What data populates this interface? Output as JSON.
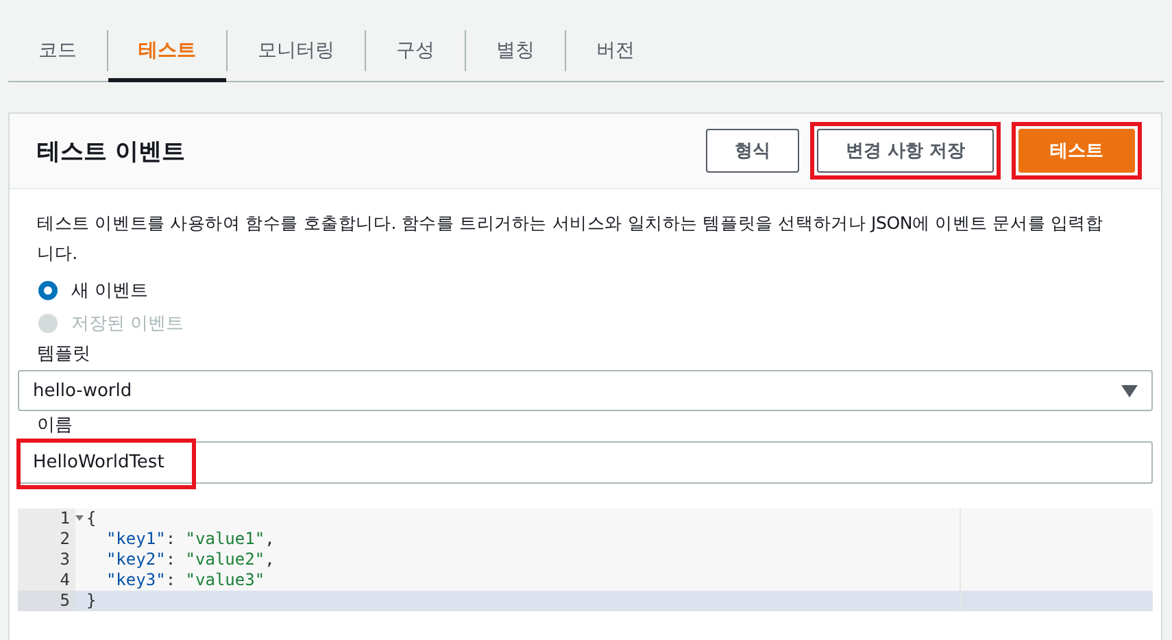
{
  "tabs": [
    {
      "label": "코드",
      "selected": false
    },
    {
      "label": "테스트",
      "selected": true
    },
    {
      "label": "모니터링",
      "selected": false
    },
    {
      "label": "구성",
      "selected": false
    },
    {
      "label": "별칭",
      "selected": false
    },
    {
      "label": "버전",
      "selected": false
    }
  ],
  "panel": {
    "title": "테스트 이벤트",
    "buttons": [
      {
        "label": "형식",
        "kind": "normal",
        "highlighted": false
      },
      {
        "label": "변경 사항 저장",
        "kind": "normal",
        "highlighted": true
      },
      {
        "label": "테스트",
        "kind": "primary",
        "highlighted": true
      }
    ],
    "description": "테스트 이벤트를 사용하여 함수를 호출합니다. 함수를 트리거하는 서비스와 일치하는 템플릿을 선택하거나 JSON에 이벤트 문서를 입력합니다.",
    "radios": [
      {
        "label": "새 이벤트",
        "selected": true,
        "disabled": false
      },
      {
        "label": "저장된 이벤트",
        "selected": false,
        "disabled": true
      }
    ],
    "template": {
      "label": "템플릿",
      "value": "hello-world"
    },
    "name": {
      "label": "이름",
      "value": "HelloWorldTest",
      "highlighted": true
    },
    "editor": {
      "lines": [
        {
          "number": "1",
          "kind": "brace",
          "text": "{",
          "foldable": true,
          "active": false
        },
        {
          "number": "2",
          "kind": "pair",
          "key": "\"key1\"",
          "sep": ": ",
          "value": "\"value1\"",
          "trail": ",",
          "foldable": false,
          "active": false
        },
        {
          "number": "3",
          "kind": "pair",
          "key": "\"key2\"",
          "sep": ": ",
          "value": "\"value2\"",
          "trail": ",",
          "foldable": false,
          "active": false
        },
        {
          "number": "4",
          "kind": "pair",
          "key": "\"key3\"",
          "sep": ": ",
          "value": "\"value3\"",
          "foldable": false,
          "active": false
        },
        {
          "number": "5",
          "kind": "brace",
          "text": "}",
          "foldable": false,
          "active": true
        }
      ]
    }
  }
}
